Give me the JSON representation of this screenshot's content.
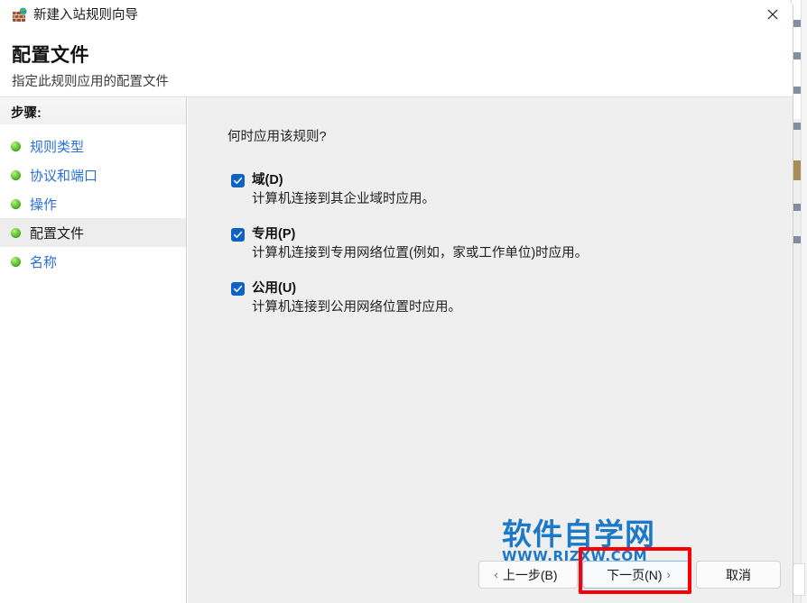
{
  "window": {
    "title": "新建入站规则向导",
    "icon": "firewall-globe-icon",
    "close_label": "✕"
  },
  "header": {
    "title": "配置文件",
    "subtitle": "指定此规则应用的配置文件"
  },
  "sidebar": {
    "heading": "步骤:",
    "items": [
      {
        "label": "规则类型",
        "current": false
      },
      {
        "label": "协议和端口",
        "current": false
      },
      {
        "label": "操作",
        "current": false
      },
      {
        "label": "配置文件",
        "current": true
      },
      {
        "label": "名称",
        "current": false
      }
    ]
  },
  "content": {
    "question": "何时应用该规则?",
    "options": [
      {
        "title": "域(D)",
        "description": "计算机连接到其企业域时应用。",
        "checked": true
      },
      {
        "title": "专用(P)",
        "description": "计算机连接到专用网络位置(例如，家或工作单位)时应用。",
        "checked": true
      },
      {
        "title": "公用(U)",
        "description": "计算机连接到公用网络位置时应用。",
        "checked": true
      }
    ]
  },
  "footer": {
    "back_chevron": "‹",
    "back_label": "上一步(B)",
    "next_label": "下一页(N)",
    "next_chevron": "›",
    "cancel_label": "取消"
  },
  "watermark": {
    "main": "软件自学网",
    "sub": "WWW.RJZXW.COM",
    "color": "#1c79c8"
  },
  "annotation": {
    "color": "#fb0000",
    "target": "next-button"
  }
}
